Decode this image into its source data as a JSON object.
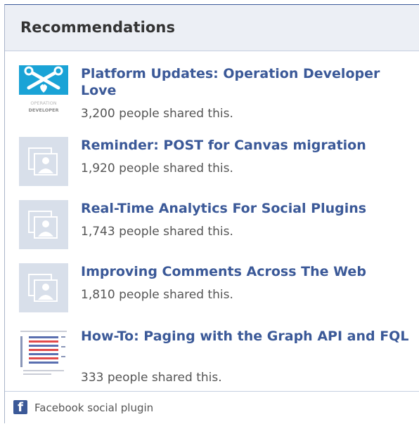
{
  "header": {
    "title": "Recommendations"
  },
  "items": [
    {
      "title": "Platform Updates: Operation Developer Love",
      "meta": "3,200 people shared this.",
      "thumb_icon": "operation-developer-love-logo",
      "thumb_text_1": "OPERATION",
      "thumb_text_2": "DEVELOPER"
    },
    {
      "title": "Reminder: POST for Canvas migration",
      "meta": "1,920 people shared this.",
      "thumb_icon": "default-page-icon"
    },
    {
      "title": "Real-Time Analytics For Social Plugins",
      "meta": "1,743 people shared this.",
      "thumb_icon": "default-page-icon"
    },
    {
      "title": "Improving Comments Across The Web",
      "meta": "1,810 people shared this.",
      "thumb_icon": "default-page-icon"
    },
    {
      "title": "How-To: Paging with the Graph API and FQL",
      "meta": "333 people shared this.",
      "thumb_icon": "document-chart-thumbnail"
    }
  ],
  "footer": {
    "logo_letter": "f",
    "text": "Facebook social plugin"
  },
  "colors": {
    "link": "#3b5998",
    "header_bg": "#eceff5",
    "border": "#c5cfe0",
    "meta_text": "#555555"
  }
}
